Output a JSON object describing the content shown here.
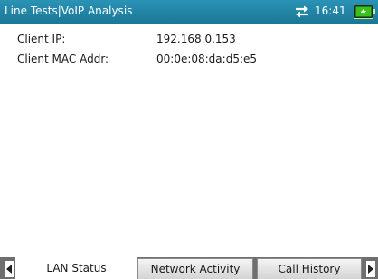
{
  "header": {
    "title": "Line Tests|VoIP Analysis",
    "time": "16:41",
    "network_icon": "network-arrows-icon",
    "battery_icon": "battery-icon"
  },
  "info": {
    "rows": [
      {
        "label": "Client IP:",
        "value": "192.168.0.153"
      },
      {
        "label": "Client MAC Addr:",
        "value": "00:0e:08:da:d5:e5"
      }
    ]
  },
  "tabs": [
    {
      "label": "LAN Status",
      "active": true
    },
    {
      "label": "Network Activity",
      "active": false
    },
    {
      "label": "Call History",
      "active": false
    }
  ],
  "colors": {
    "title_bar": "#1f82a4",
    "tab_strip": "#6f6f6f",
    "battery": "#39c21f"
  }
}
